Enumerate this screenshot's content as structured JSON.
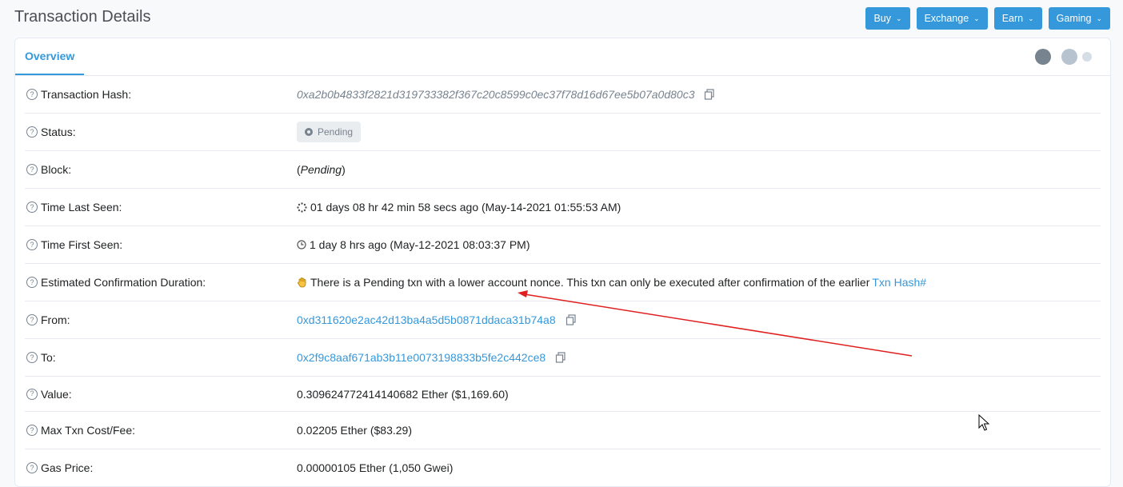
{
  "page": {
    "title": "Transaction Details"
  },
  "header_buttons": [
    {
      "label": "Buy"
    },
    {
      "label": "Exchange"
    },
    {
      "label": "Earn"
    },
    {
      "label": "Gaming"
    }
  ],
  "tabs": {
    "overview": "Overview"
  },
  "rows": {
    "tx_hash": {
      "label": "Transaction Hash:",
      "value": "0xa2b0b4833f2821d319733382f367c20c8599c0ec37f78d16d67ee5b07a0d80c3"
    },
    "status": {
      "label": "Status:",
      "value": "Pending"
    },
    "block": {
      "label": "Block:",
      "prefix": "(",
      "value": "Pending",
      "suffix": ")"
    },
    "time_last": {
      "label": "Time Last Seen:",
      "value": "01 days 08 hr 42 min 58 secs ago (May-14-2021 01:55:53 AM)"
    },
    "time_first": {
      "label": "Time First Seen:",
      "value": "1 day 8 hrs ago (May-12-2021 08:03:37 PM)"
    },
    "est_conf": {
      "label": "Estimated Confirmation Duration:",
      "value": "There is a Pending txn with a lower account nonce. This txn can only be executed after confirmation of the earlier",
      "link": "Txn Hash#"
    },
    "from": {
      "label": "From:",
      "value": "0xd311620e2ac42d13ba4a5d5b0871ddaca31b74a8"
    },
    "to": {
      "label": "To:",
      "value": "0x2f9c8aaf671ab3b11e0073198833b5fe2c442ce8"
    },
    "value": {
      "label": "Value:",
      "value": "0.309624772414140682 Ether ($1,169.60)"
    },
    "max_fee": {
      "label": "Max Txn Cost/Fee:",
      "value": "0.02205 Ether ($83.29)"
    },
    "gas_price": {
      "label": "Gas Price:",
      "value": "0.00000105 Ether (1,050 Gwei)"
    }
  },
  "colors": {
    "accent": "#3498db",
    "muted": "#77838f",
    "annotation": "#e02020"
  }
}
